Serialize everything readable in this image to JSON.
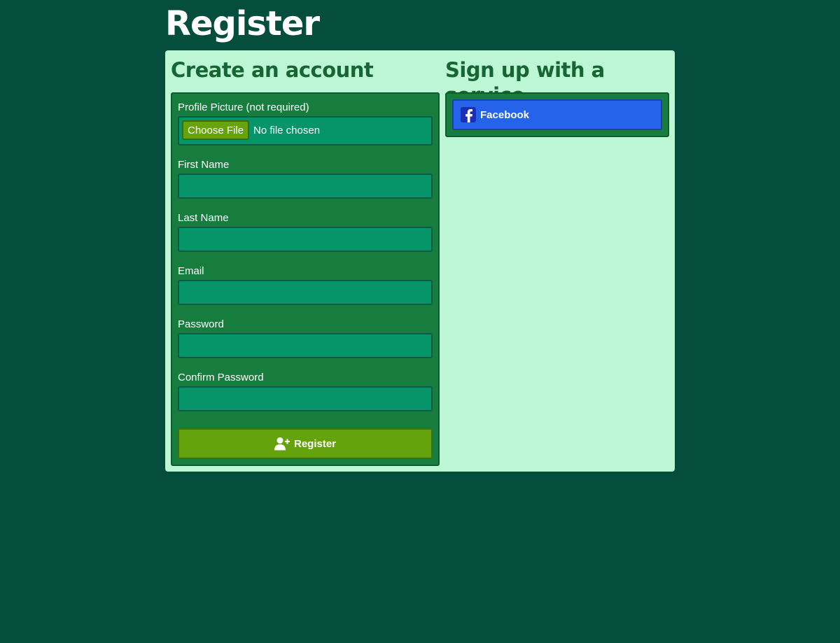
{
  "page": {
    "title": "Register"
  },
  "left_column": {
    "title": "Create an account",
    "profile_picture": {
      "label": "Profile Picture (not required)",
      "button_label": "Choose File",
      "status": "No file chosen"
    },
    "fields": [
      {
        "label": "First Name",
        "value": ""
      },
      {
        "label": "Last Name",
        "value": ""
      },
      {
        "label": "Email",
        "value": ""
      },
      {
        "label": "Password",
        "value": ""
      },
      {
        "label": "Confirm Password",
        "value": ""
      }
    ],
    "submit": {
      "label": "Register",
      "icon": "user-plus-icon"
    }
  },
  "right_column": {
    "title": "Sign up with a service",
    "services": [
      {
        "label": "Facebook",
        "icon": "facebook-icon"
      }
    ]
  },
  "colors": {
    "page_background": "#054d3c",
    "card_background": "#bdf6d4",
    "panel_background": "#177d3e",
    "input_background": "#069569",
    "register_button": "#65a30d",
    "facebook_button": "#2563eb",
    "heading_green": "#166534"
  }
}
